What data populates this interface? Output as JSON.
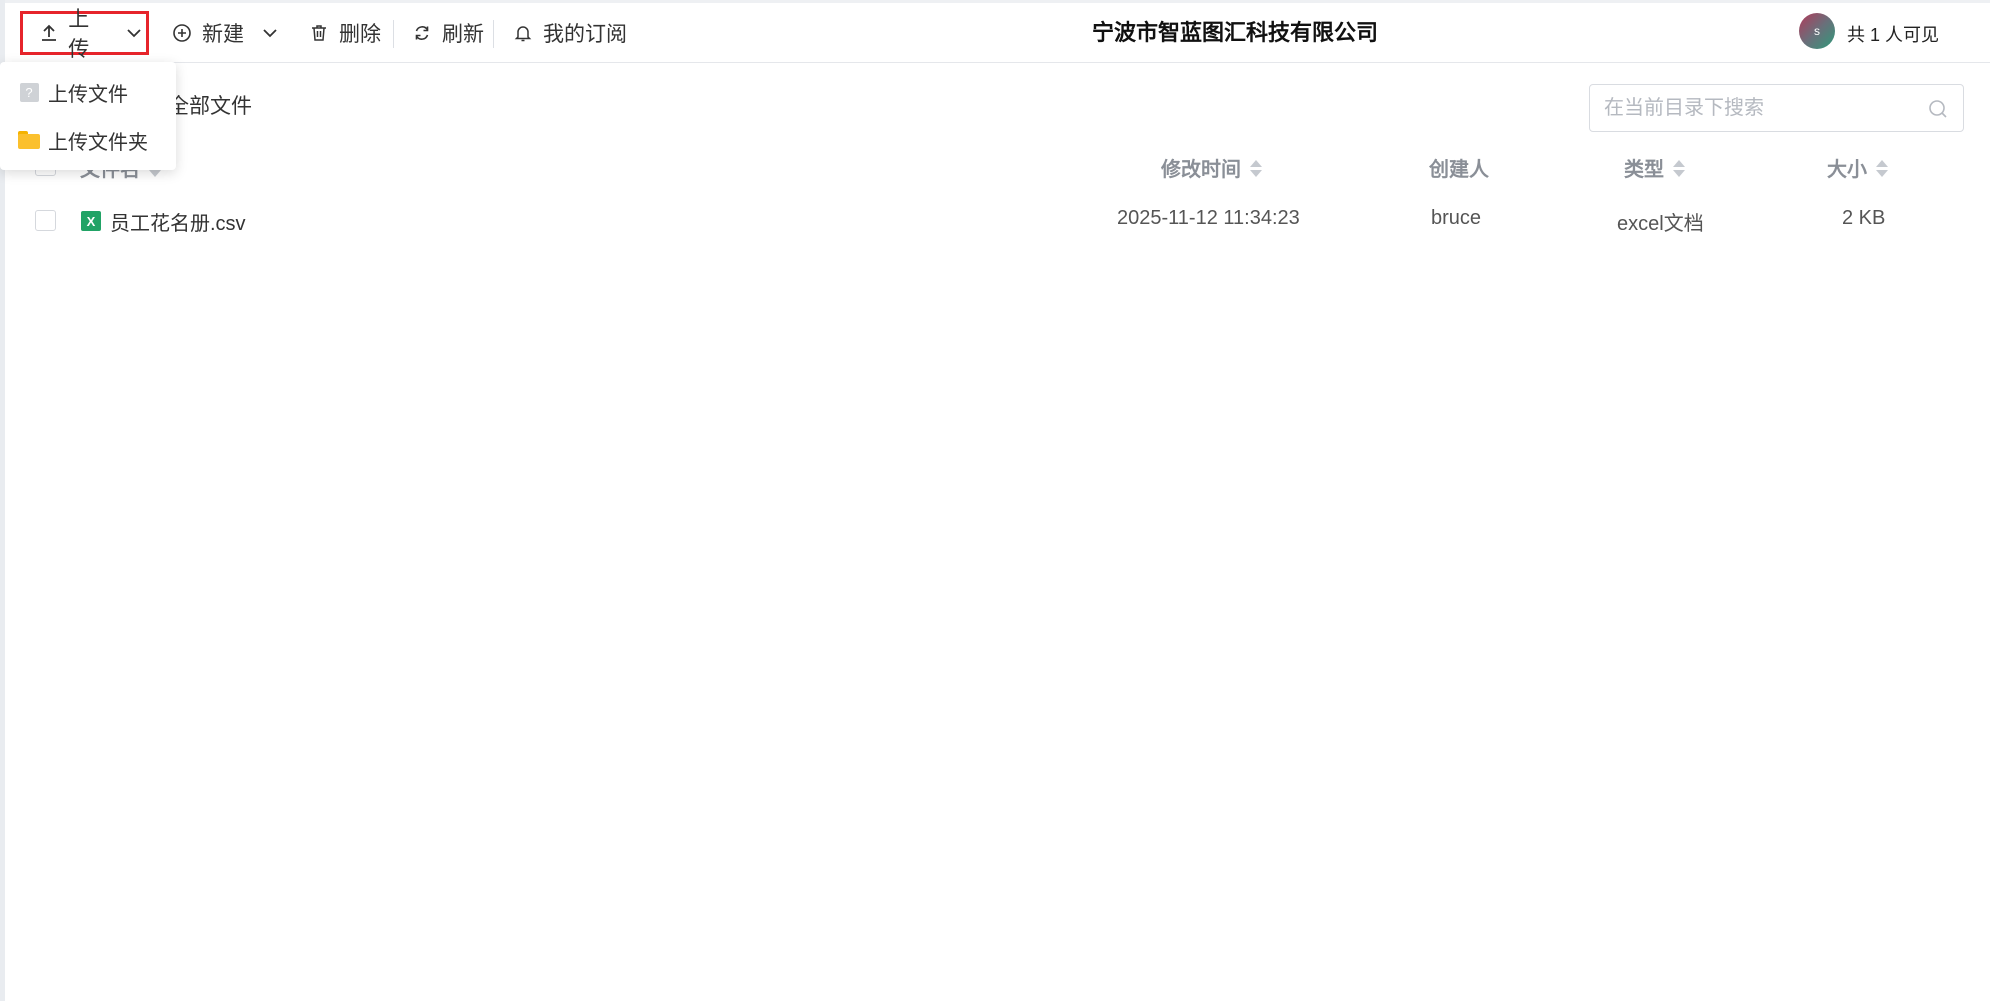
{
  "toolbar": {
    "upload_label": "上传",
    "new_label": "新建",
    "delete_label": "删除",
    "refresh_label": "刷新",
    "subscription_label": "我的订阅"
  },
  "header": {
    "company_name": "宁波市智蓝图汇科技有限公司",
    "avatar_initial": "s",
    "visibility_text": "共 1 人可见"
  },
  "breadcrumb": {
    "label": "全部文件"
  },
  "search": {
    "placeholder": "在当前目录下搜索",
    "value": ""
  },
  "upload_menu": {
    "items": [
      {
        "label": "上传文件",
        "icon": "file-unknown-icon"
      },
      {
        "label": "上传文件夹",
        "icon": "folder-icon"
      }
    ]
  },
  "table": {
    "columns": {
      "name": "文件名",
      "modified": "修改时间",
      "creator": "创建人",
      "type": "类型",
      "size": "大小"
    },
    "rows": [
      {
        "icon_glyph": "X",
        "name": "员工花名册.csv",
        "modified": "2025-11-12 11:34:23",
        "creator": "bruce",
        "type": "excel文档",
        "size": "2 KB"
      }
    ]
  },
  "colors": {
    "highlight_border": "#e6242b",
    "excel_green": "#21a366",
    "folder_yellow": "#fbc02d"
  }
}
